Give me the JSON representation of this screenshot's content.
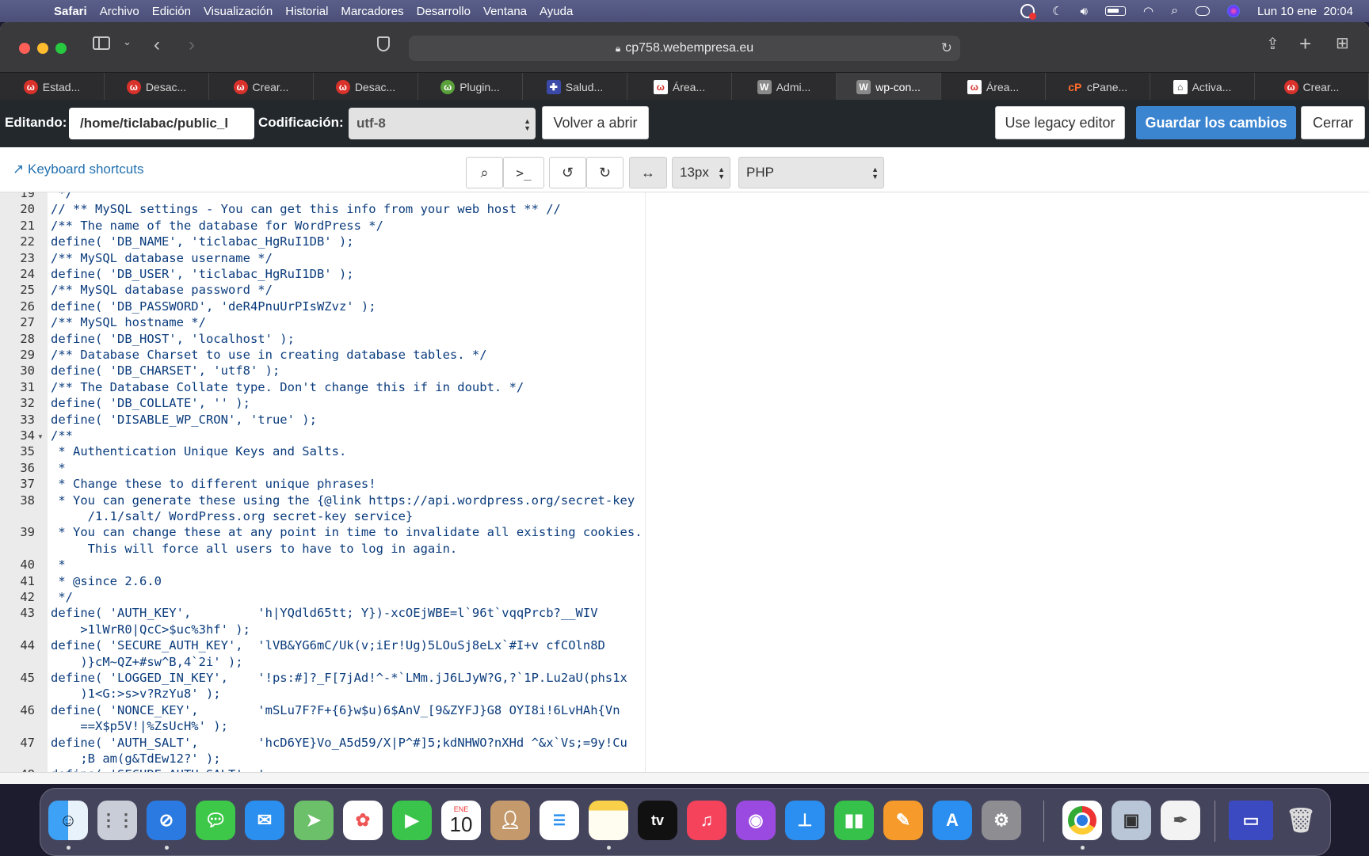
{
  "menubar": {
    "app": "Safari",
    "items": [
      "Archivo",
      "Edición",
      "Visualización",
      "Historial",
      "Marcadores",
      "Desarrollo",
      "Ventana",
      "Ayuda"
    ],
    "clock": "Lun 10 ene  20:04"
  },
  "browser": {
    "url": "cp758.webempresa.eu",
    "tabs": [
      {
        "label": "Estad...",
        "icon": "webempresa-icon"
      },
      {
        "label": "Desac...",
        "icon": "webempresa-icon"
      },
      {
        "label": "Crear...",
        "icon": "webempresa-icon"
      },
      {
        "label": "Desac...",
        "icon": "webempresa-icon"
      },
      {
        "label": "Plugin...",
        "icon": "wp-plugin-icon"
      },
      {
        "label": "Salud...",
        "icon": "health-icon"
      },
      {
        "label": "Área...",
        "icon": "webempresa-square-icon"
      },
      {
        "label": "Admi...",
        "icon": "wordpress-icon"
      },
      {
        "label": "wp-con...",
        "icon": "wordpress-icon"
      },
      {
        "label": "Área...",
        "icon": "webempresa-square-icon"
      },
      {
        "label": "cPane...",
        "icon": "cpanel-icon"
      },
      {
        "label": "Activa...",
        "icon": "activation-icon"
      },
      {
        "label": "Crear...",
        "icon": "webempresa-icon"
      }
    ]
  },
  "editor_bar": {
    "editing_label": "Editando:",
    "path": "/home/ticlabac/public_l",
    "encoding_label": "Codificación:",
    "encoding": "utf-8",
    "reopen": "Volver a abrir",
    "legacy": "Use legacy editor",
    "save": "Guardar los cambios",
    "close": "Cerrar"
  },
  "subbar": {
    "shortcuts": "Keyboard shortcuts",
    "font_size": "13px",
    "mode": "PHP"
  },
  "code_lines": [
    {
      "n": "19",
      "t": " */"
    },
    {
      "n": "20",
      "t": "// ** MySQL settings - You can get this info from your web host ** //"
    },
    {
      "n": "21",
      "t": "/** The name of the database for WordPress */"
    },
    {
      "n": "22",
      "t": "define( 'DB_NAME', 'ticlabac_HgRuI1DB' );"
    },
    {
      "n": "23",
      "t": "/** MySQL database username */"
    },
    {
      "n": "24",
      "t": "define( 'DB_USER', 'ticlabac_HgRuI1DB' );"
    },
    {
      "n": "25",
      "t": "/** MySQL database password */"
    },
    {
      "n": "26",
      "t": "define( 'DB_PASSWORD', 'deR4PnuUrPIsWZvz' );"
    },
    {
      "n": "27",
      "t": "/** MySQL hostname */"
    },
    {
      "n": "28",
      "t": "define( 'DB_HOST', 'localhost' );"
    },
    {
      "n": "29",
      "t": "/** Database Charset to use in creating database tables. */"
    },
    {
      "n": "30",
      "t": "define( 'DB_CHARSET', 'utf8' );"
    },
    {
      "n": "31",
      "t": "/** The Database Collate type. Don't change this if in doubt. */"
    },
    {
      "n": "32",
      "t": "define( 'DB_COLLATE', '' );"
    },
    {
      "n": "33",
      "t": "define( 'DISABLE_WP_CRON', 'true' );"
    },
    {
      "n": "34",
      "t": "/**"
    },
    {
      "n": "35",
      "t": " * Authentication Unique Keys and Salts."
    },
    {
      "n": "36",
      "t": " *"
    },
    {
      "n": "37",
      "t": " * Change these to different unique phrases!"
    },
    {
      "n": "38",
      "t": " * You can generate these using the {@link https://api.wordpress.org/secret-key"
    },
    {
      "n": "",
      "t": "     /1.1/salt/ WordPress.org secret-key service}"
    },
    {
      "n": "39",
      "t": " * You can change these at any point in time to invalidate all existing cookies."
    },
    {
      "n": "",
      "t": "     This will force all users to have to log in again."
    },
    {
      "n": "40",
      "t": " *"
    },
    {
      "n": "41",
      "t": " * @since 2.6.0"
    },
    {
      "n": "42",
      "t": " */"
    },
    {
      "n": "43",
      "t": "define( 'AUTH_KEY',         'h|YQdld65tt; Y})-xcOEjWBE=l`96t`vqqPrcb?__WIV"
    },
    {
      "n": "",
      "t": "    >1lWrR0|QcC>$uc%3hf' );"
    },
    {
      "n": "44",
      "t": "define( 'SECURE_AUTH_KEY',  'lVB&YG6mC/Uk(v;iEr!Ug)5LOuSj8eLx`#I+v cfCOln8D"
    },
    {
      "n": "",
      "t": "    )}cM~QZ+#sw^B,4`2i' );"
    },
    {
      "n": "45",
      "t": "define( 'LOGGED_IN_KEY',    '!ps:#]?_F[7jAd!^-*`LMm.jJ6LJyW?G,?`1P.Lu2aU(phs1x"
    },
    {
      "n": "",
      "t": "    )1<G:>s>v?RzYu8' );"
    },
    {
      "n": "46",
      "t": "define( 'NONCE_KEY',        'mSLu7F?F+{6}w$u)6$AnV_[9&ZYFJ}G8 OYI8i!6LvHAh{Vn"
    },
    {
      "n": "",
      "t": "    ==X$p5V!|%ZsUcH%' );"
    },
    {
      "n": "47",
      "t": "define( 'AUTH_SALT',        'hcD6YE}Vo_A5d59/X|P^#]5;kdNHWO?nXHd ^&x`Vs;=9y!Cu"
    },
    {
      "n": "",
      "t": "    ;B am(g&TdEw12?' );"
    },
    {
      "n": "48",
      "t": "define( 'SECURE_AUTH_SALT', '"
    }
  ],
  "dock": {
    "calendar_month": "ENE",
    "calendar_day": "10",
    "tv_label": "tv"
  }
}
